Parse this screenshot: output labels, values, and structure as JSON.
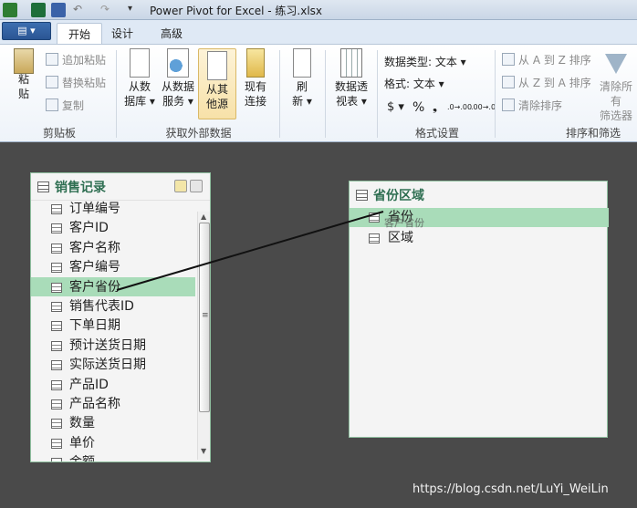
{
  "window": {
    "title": "Power Pivot for Excel - 练习.xlsx"
  },
  "quick_access": [
    "powerpivot-icon",
    "excel-icon",
    "save-icon",
    "undo-icon",
    "redo-icon",
    "customize-icon"
  ],
  "file_button": {
    "label": "▤ ▾"
  },
  "tabs": [
    {
      "label": "开始",
      "active": true
    },
    {
      "label": "设计",
      "active": false
    },
    {
      "label": "高级",
      "active": false
    }
  ],
  "ribbon": {
    "clipboard": {
      "paste": "粘\n贴",
      "append_paste": "追加粘贴",
      "replace_paste": "替换粘贴",
      "copy": "复制",
      "group_label": "剪贴板"
    },
    "external_data": {
      "from_database": "从数\n据库 ▾",
      "from_data_service": "从数据\n服务 ▾",
      "from_other_sources": "从其\n他源",
      "existing_connections": "现有\n连接",
      "group_label": "获取外部数据"
    },
    "refresh": {
      "label": "刷\n新 ▾"
    },
    "pivot": {
      "label": "数据透\n视表 ▾"
    },
    "formatting": {
      "data_type": "数据类型: 文本 ▾",
      "format": "格式: 文本 ▾",
      "currency": "$ ▾",
      "percent": "%",
      "comma": "❟",
      "inc_decimal": ".0→.00",
      "dec_decimal": ".00→.0",
      "group_label": "格式设置"
    },
    "sort_filter": {
      "sort_az": "从 A 到 Z 排序",
      "sort_za": "从 Z 到 A 排序",
      "clear_sort": "清除排序",
      "clear_all_filters": "清除所有\n筛选器",
      "group_label": "排序和筛选"
    }
  },
  "tables": [
    {
      "name": "销售记录",
      "fields": [
        "订单编号",
        "客户ID",
        "客户名称",
        "客户编号",
        "客户省份",
        "销售代表ID",
        "下单日期",
        "预计送货日期",
        "实际送货日期",
        "产品ID",
        "产品名称",
        "数量",
        "单价",
        "金额"
      ],
      "highlighted": "客户省份"
    },
    {
      "name": "省份区域",
      "fields": [
        "省份",
        "区域"
      ],
      "highlighted": "省份",
      "drag_label": "客户省份"
    }
  ],
  "watermark": "https://blog.csdn.net/LuYi_WeiLin",
  "colors": {
    "accent": "#2f6f52",
    "highlight": "#a9dcb9",
    "canvas": "#4a4a4a"
  }
}
